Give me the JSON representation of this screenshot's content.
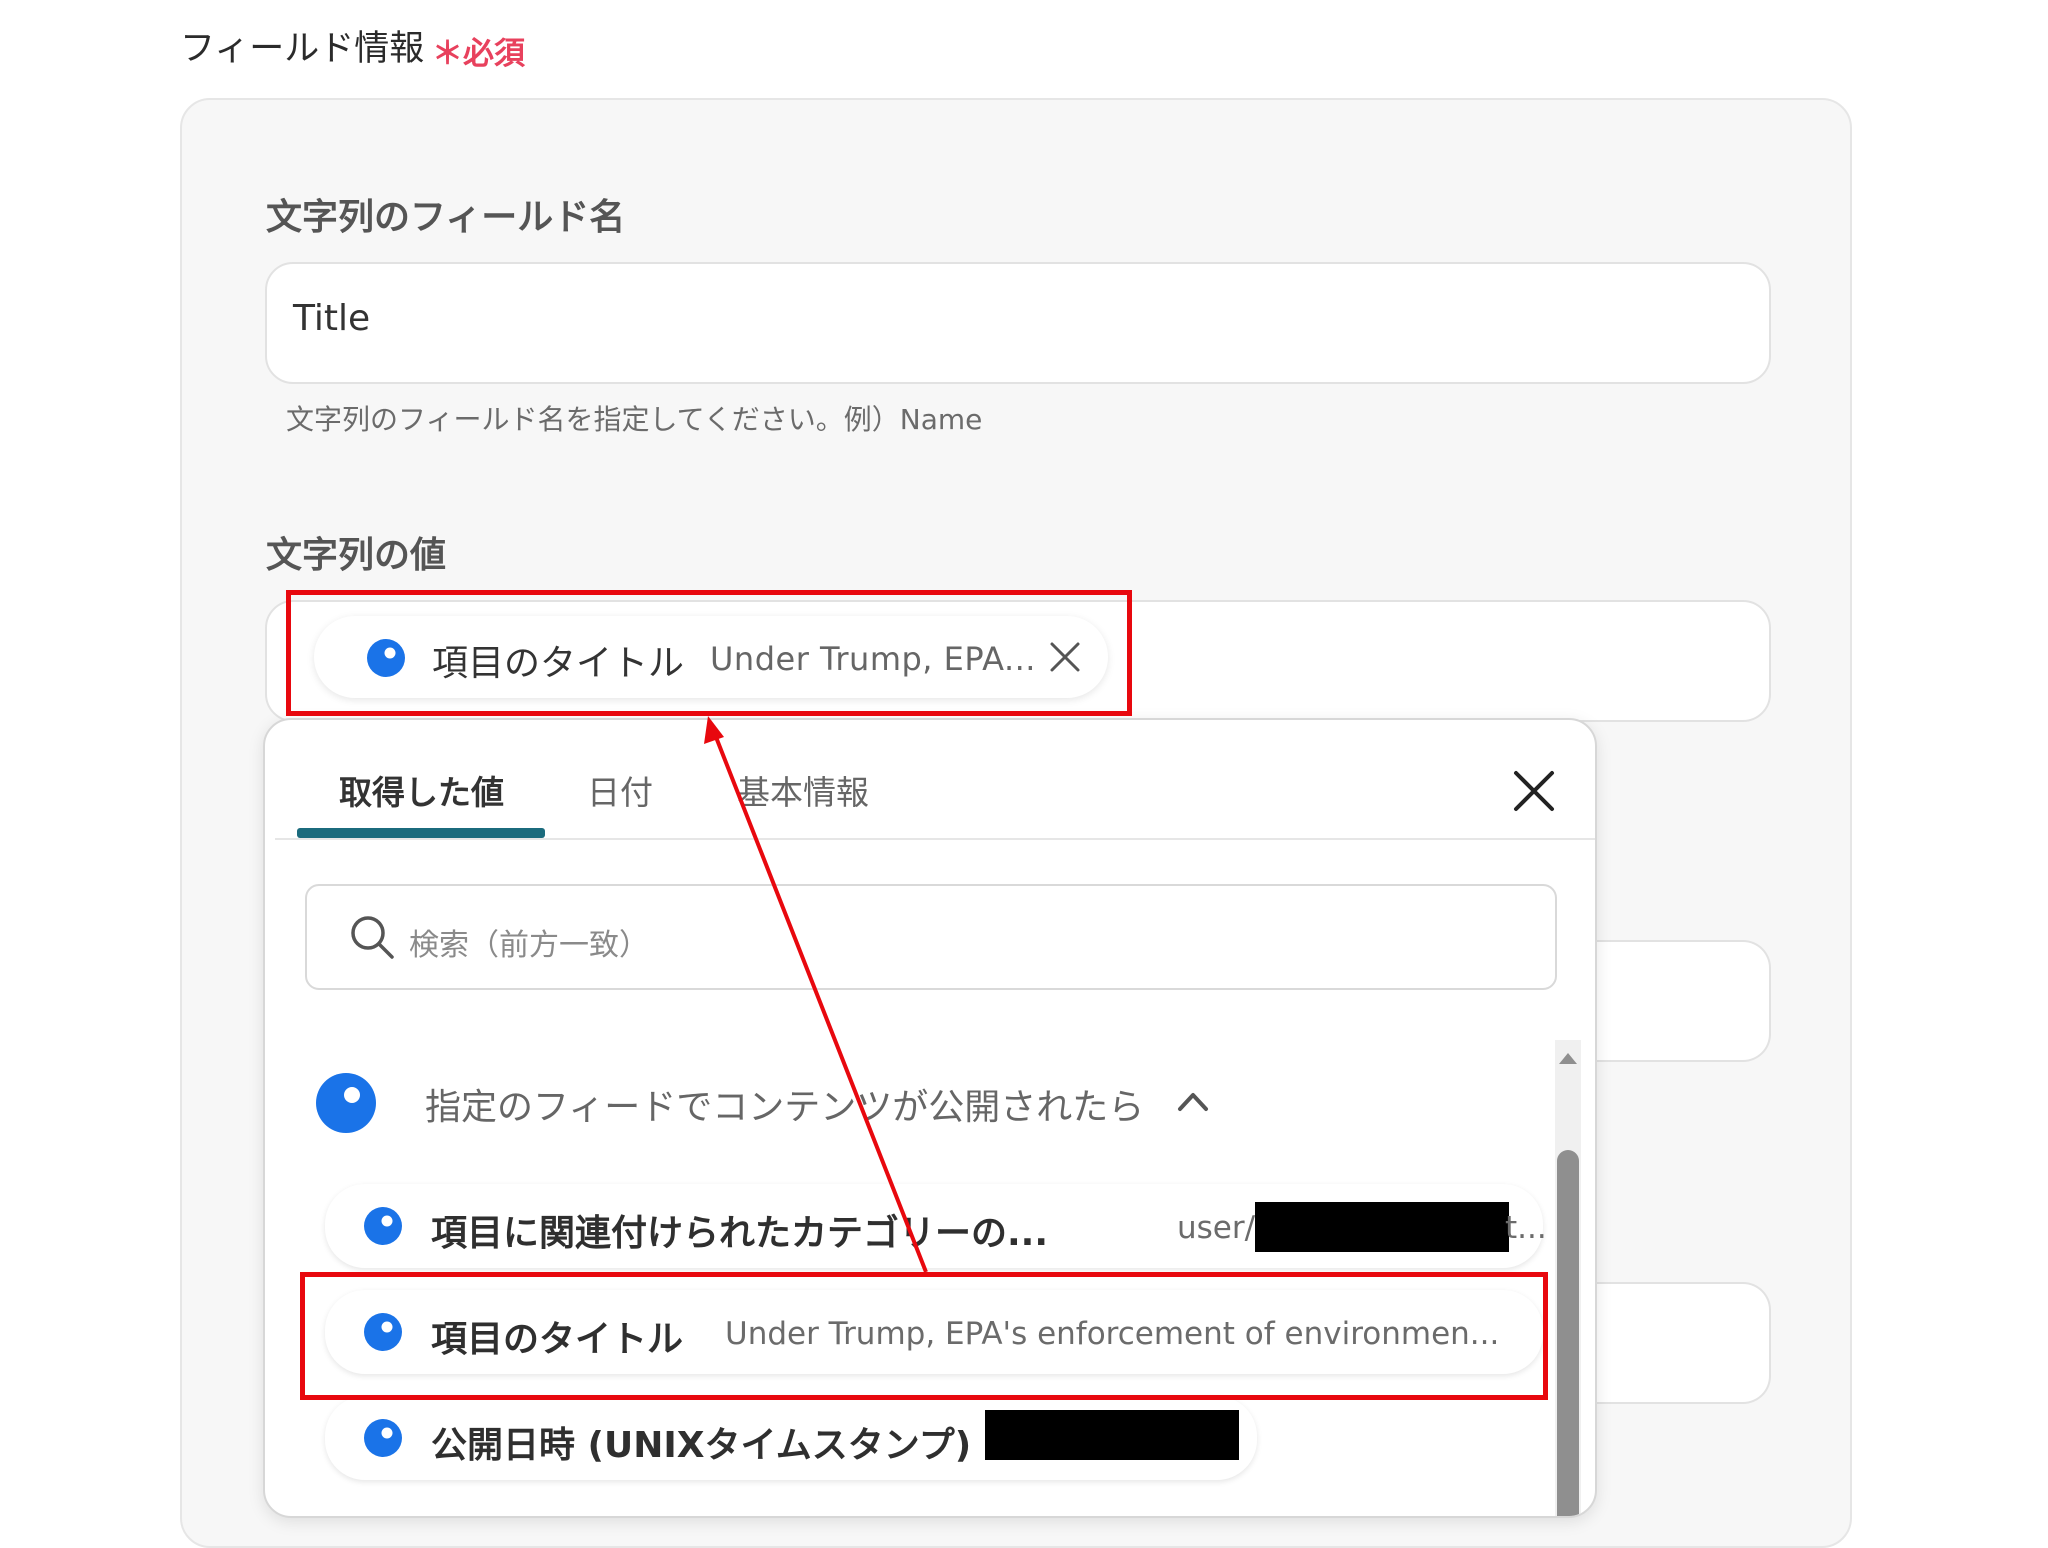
{
  "section": {
    "title": "フィールド情報",
    "required": "＊必須"
  },
  "field_name": {
    "label": "文字列のフィールド名",
    "value": "Title",
    "helper": "文字列のフィールド名を指定してください。例）Name"
  },
  "field_value": {
    "label": "文字列の値",
    "chip": {
      "label": "項目のタイトル",
      "preview": "Under Trump, EPA...",
      "remove_icon": "close-icon"
    }
  },
  "dropdown": {
    "tabs": [
      {
        "label": "取得した値",
        "active": true
      },
      {
        "label": "日付",
        "active": false
      },
      {
        "label": "基本情報",
        "active": false
      }
    ],
    "close_icon": "close-icon",
    "search": {
      "placeholder": "検索（前方一致）",
      "icon": "search-icon"
    },
    "group": {
      "title": "指定のフィードでコンテンツが公開されたら",
      "toggle_icon": "chevron-up-icon"
    },
    "items": [
      {
        "label": "項目に関連付けられたカテゴリーの...",
        "preview_prefix": "user/",
        "preview_suffix": "t..."
      },
      {
        "label": "項目のタイトル",
        "preview": "Under Trump, EPA's enforcement of environmen..."
      },
      {
        "label": "公開日時 (UNIXタイムスタンプ)"
      }
    ]
  },
  "colors": {
    "accent_blue": "#1a73e8",
    "highlight_red": "#e8080e",
    "required_pink": "#e8415d",
    "tab_underline": "#1b6b7d"
  }
}
